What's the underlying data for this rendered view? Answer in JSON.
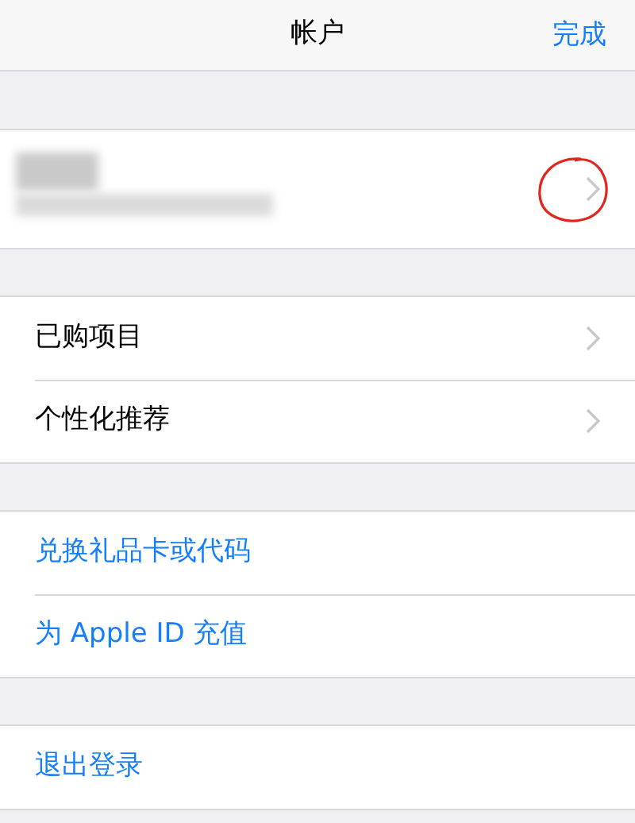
{
  "nav_bar": {
    "title": "帐户",
    "done": "完成"
  },
  "sections": [
    {
      "rows": [
        {
          "label": "已购项目",
          "kind": "nav"
        },
        {
          "label": "个性化推荐",
          "kind": "nav"
        }
      ]
    },
    {
      "rows": [
        {
          "label": "兑换礼品卡或代码",
          "kind": "action"
        },
        {
          "label": "为 Apple ID 充值",
          "kind": "action"
        }
      ]
    },
    {
      "rows": [
        {
          "label": "退出登录",
          "kind": "action"
        }
      ]
    }
  ]
}
